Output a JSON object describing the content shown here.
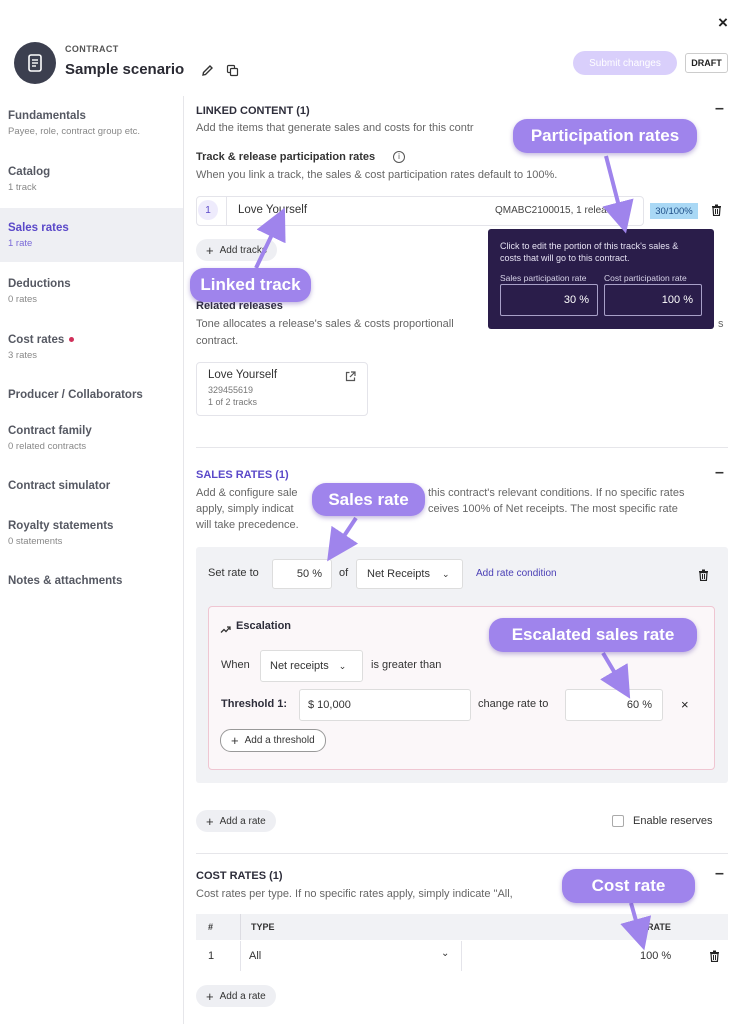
{
  "header": {
    "kicker": "CONTRACT",
    "title": "Sample scenario",
    "submit_label": "Submit changes",
    "status_badge": "DRAFT",
    "close_glyph": "×"
  },
  "sidebar": {
    "items": [
      {
        "title": "Fundamentals",
        "subtitle": "Payee, role, contract group etc."
      },
      {
        "title": "Catalog",
        "subtitle": "1 track"
      },
      {
        "title": "Sales rates",
        "subtitle": "1 rate"
      },
      {
        "title": "Deductions",
        "subtitle": "0 rates"
      },
      {
        "title": "Cost rates",
        "subtitle": "3 rates"
      },
      {
        "title": "Producer / Collaborators",
        "subtitle": ""
      },
      {
        "title": "Contract family",
        "subtitle": "0 related contracts"
      },
      {
        "title": "Contract simulator",
        "subtitle": ""
      },
      {
        "title": "Royalty statements",
        "subtitle": "0 statements"
      },
      {
        "title": "Notes & attachments",
        "subtitle": ""
      }
    ]
  },
  "linked": {
    "title": "LINKED CONTENT (1)",
    "desc": "Add the items that generate sales and costs for this contr",
    "sub_title": "Track & release participation rates",
    "sub_desc": "When you link a track, the sales & cost participation rates default to 100%.",
    "row_num": "1",
    "track_name": "Love Yourself",
    "track_meta": "QMABC2100015, 1 release",
    "rate_badge": "30/100%",
    "add_tracks": "Add tracks",
    "related_title": "Related releases",
    "related_desc_1": "Tone allocates a release's sales & costs proportionall",
    "related_desc_2": "contract.",
    "related_desc_tail": "s",
    "release_name": "Love Yourself",
    "release_id": "329455619",
    "release_tracks": "1 of 2 tracks"
  },
  "tooltip": {
    "text": "Click to edit the portion of this track's sales & costs that will go to this contract.",
    "sales_label": "Sales participation rate",
    "cost_label": "Cost participation rate",
    "sales_value": "30 %",
    "cost_value": "100 %"
  },
  "sales": {
    "title": "SALES RATES (1)",
    "desc_1a": "Add & configure sale",
    "desc_1b": "this contract's relevant conditions. If no specific rates",
    "desc_2a": "apply, simply indicat",
    "desc_2b": "ceives 100% of Net receipts. The most specific rate",
    "desc_3": "will take precedence.",
    "set_rate_label": "Set rate to",
    "rate_value": "50 %",
    "of_label": "of",
    "basis": "Net Receipts",
    "add_condition": "Add rate condition",
    "escalation_title": "Escalation",
    "when_label": "When",
    "when_value": "Net receipts",
    "greater_label": "is greater than",
    "threshold_label": "Threshold 1:",
    "threshold_value": "$ 10,000",
    "change_label": "change rate to",
    "change_value": "60 %",
    "add_threshold": "Add a threshold",
    "add_rate": "Add a rate",
    "enable_reserves": "Enable reserves"
  },
  "cost": {
    "title": "COST RATES (1)",
    "desc": "Cost rates per type. If no specific rates apply, simply indicate \"All,",
    "col_num": "#",
    "col_type": "TYPE",
    "col_rate": "RATE",
    "row_num": "1",
    "row_type": "All",
    "row_rate": "100 %",
    "add_rate": "Add a rate"
  },
  "callouts": {
    "participation": "Participation rates",
    "linked_track": "Linked track",
    "sales_rate": "Sales rate",
    "escalated": "Escalated sales rate",
    "cost_rate": "Cost rate"
  },
  "colors": {
    "accent": "#5a48c9",
    "callout": "#9f84ec",
    "tooltip_bg": "#2a1d4a",
    "badge_bg": "#a9d8f5"
  }
}
